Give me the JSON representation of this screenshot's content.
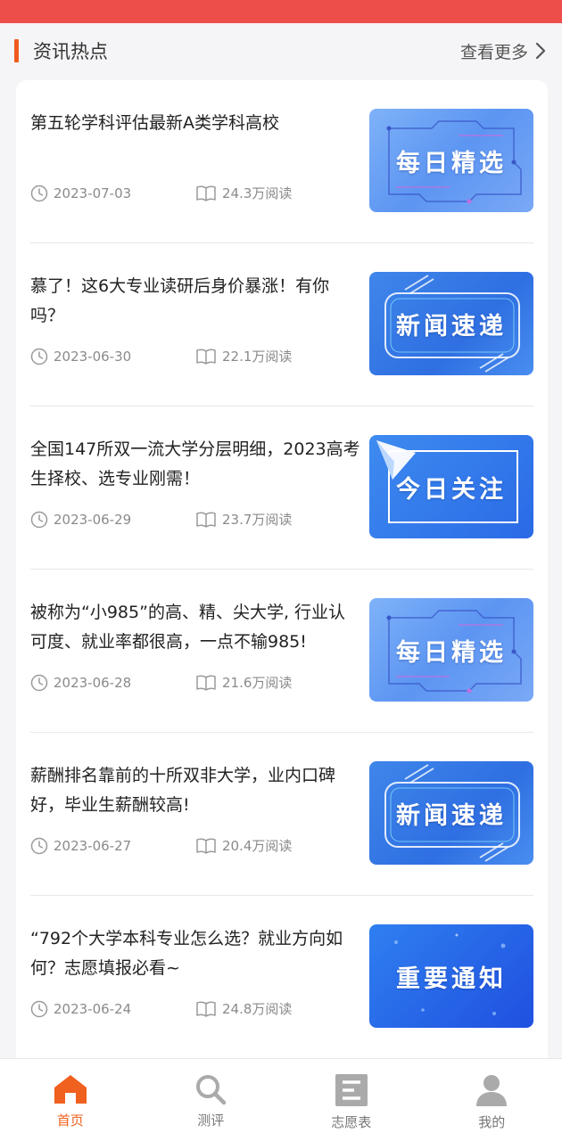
{
  "section": {
    "title": "资讯热点",
    "more_label": "查看更多"
  },
  "news": [
    {
      "title": "第五轮学科评估最新A类学科高校",
      "date": "2023-07-03",
      "reads": "24.3万阅读",
      "thumb_text": "每日精选",
      "thumb_style": "daily"
    },
    {
      "title": "慕了！这6大专业读研后身价暴涨！有你吗？",
      "date": "2023-06-30",
      "reads": "22.1万阅读",
      "thumb_text": "新闻速递",
      "thumb_style": "news"
    },
    {
      "title": "全国147所双一流大学分层明细，2023高考生择校、选专业刚需！",
      "date": "2023-06-29",
      "reads": "23.7万阅读",
      "thumb_text": "今日关注",
      "thumb_style": "today"
    },
    {
      "title": "被称为“小985”的高、精、尖大学, 行业认可度、就业率都很高，一点不输985!",
      "date": "2023-06-28",
      "reads": "21.6万阅读",
      "thumb_text": "每日精选",
      "thumb_style": "daily"
    },
    {
      "title": "薪酬排名靠前的十所双非大学，业内口碑好，毕业生薪酬较高!",
      "date": "2023-06-27",
      "reads": "20.4万阅读",
      "thumb_text": "新闻速递",
      "thumb_style": "news"
    },
    {
      "title": "“792个大学本科专业怎么选？就业方向如何？志愿填报必看~",
      "date": "2023-06-24",
      "reads": "24.8万阅读",
      "thumb_text": "重要通知",
      "thumb_style": "notice"
    }
  ],
  "tabs": [
    {
      "label": "首页",
      "icon": "home-icon",
      "active": true
    },
    {
      "label": "测评",
      "icon": "search-icon",
      "active": false
    },
    {
      "label": "志愿表",
      "icon": "form-icon",
      "active": false
    },
    {
      "label": "我的",
      "icon": "user-icon",
      "active": false
    }
  ],
  "colors": {
    "status_bar": "#ee4e4a",
    "accent": "#f05a1e",
    "active_tab": "#f0601e"
  }
}
